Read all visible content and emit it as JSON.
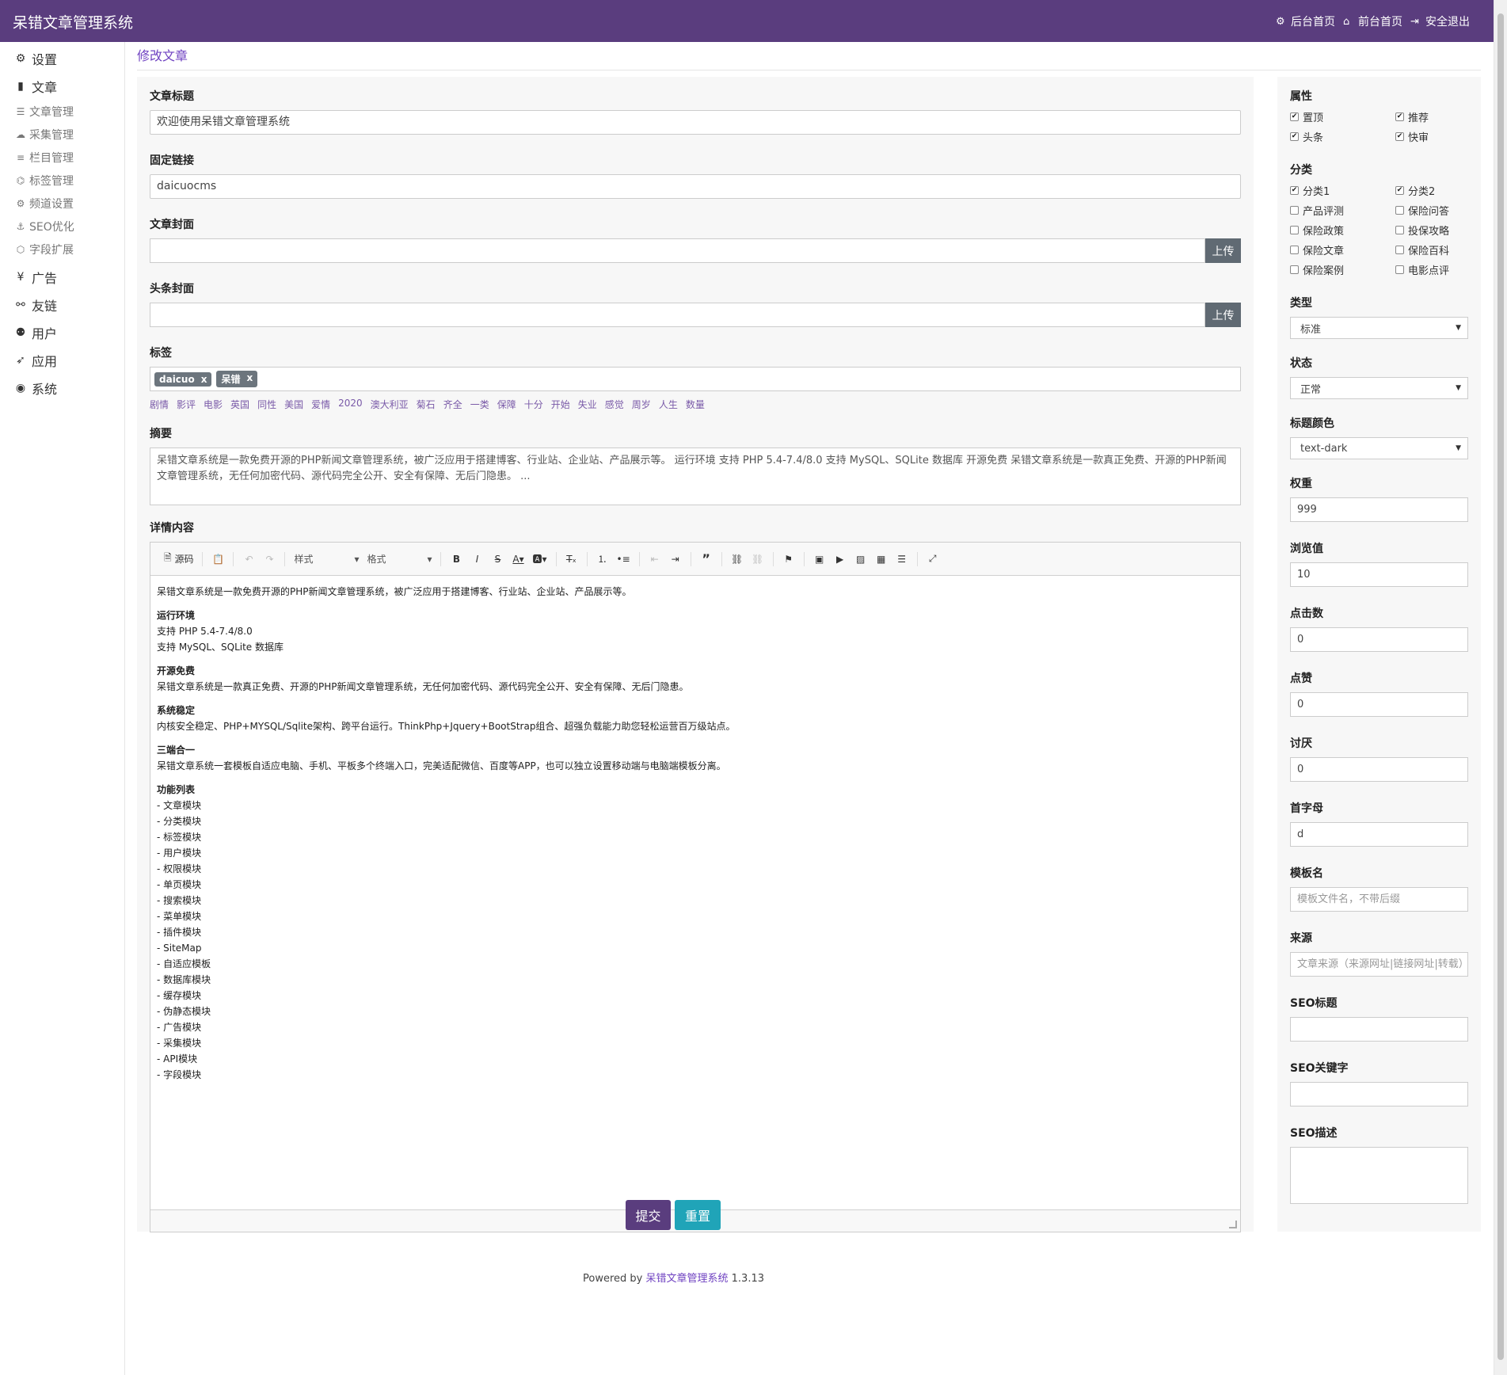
{
  "header": {
    "brand": "呆错文章管理系统",
    "links": [
      {
        "icon": "gear-icon",
        "glyph": "⚙",
        "label": "后台首页"
      },
      {
        "icon": "home-icon",
        "glyph": "⌂",
        "label": "前台首页"
      },
      {
        "icon": "logout-icon",
        "glyph": "⇥",
        "label": "安全退出"
      }
    ]
  },
  "sidebar": {
    "settings": {
      "glyph": "⚙",
      "label": "设置"
    },
    "article": {
      "glyph": "▮",
      "label": "文章"
    },
    "article_items": [
      {
        "glyph": "☰",
        "label": "文章管理"
      },
      {
        "glyph": "☁",
        "label": "采集管理"
      },
      {
        "glyph": "≡",
        "label": "栏目管理"
      },
      {
        "glyph": "⌬",
        "label": "标签管理"
      },
      {
        "glyph": "⚙",
        "label": "频道设置"
      },
      {
        "glyph": "⚓",
        "label": "SEO优化"
      },
      {
        "glyph": "⬡",
        "label": "字段扩展"
      }
    ],
    "others": [
      {
        "glyph": "¥",
        "label": "广告",
        "icon": "yen-icon"
      },
      {
        "glyph": "⚯",
        "label": "友链",
        "icon": "handshake-icon"
      },
      {
        "glyph": "⚉",
        "label": "用户",
        "icon": "users-icon"
      },
      {
        "glyph": "➶",
        "label": "应用",
        "icon": "rocket-icon"
      },
      {
        "glyph": "◉",
        "label": "系统",
        "icon": "dashboard-icon"
      }
    ]
  },
  "page": {
    "title": "修改文章"
  },
  "form": {
    "title_label": "文章标题",
    "title_value": "欢迎使用呆错文章管理系统",
    "slug_label": "固定链接",
    "slug_value": "daicuocms",
    "cover_label": "文章封面",
    "headline_cover_label": "头条封面",
    "upload_label": "上传",
    "tags_label": "标签",
    "tags": [
      "daicuo",
      "呆错"
    ],
    "tag_remove": "x",
    "tag_suggestions": [
      "剧情",
      "影评",
      "电影",
      "英国",
      "同性",
      "美国",
      "爱情",
      "2020",
      "澳大利亚",
      "菊石",
      "齐全",
      "一类",
      "保障",
      "十分",
      "开始",
      "失业",
      "感觉",
      "周岁",
      "人生",
      "数量"
    ],
    "summary_label": "摘要",
    "summary_value": "呆错文章系统是一款免费开源的PHP新闻文章管理系统，被广泛应用于搭建博客、行业站、企业站、产品展示等。 运行环境 支持 PHP 5.4-7.4/8.0 支持 MySQL、SQLite 数据库 开源免费 呆错文章系统是一款真正免费、开源的PHP新闻文章管理系统，无任何加密代码、源代码完全公开、安全有保障、无后门隐患。 ...",
    "content_label": "详情内容"
  },
  "editor": {
    "source_label": "源码",
    "style_combo": "样式",
    "format_combo": "格式",
    "intro": "呆错文章系统是一款免费开源的PHP新闻文章管理系统，被广泛应用于搭建博客、行业站、企业站、产品展示等。",
    "sections": [
      {
        "heading": "运行环境",
        "lines": [
          "支持 PHP 5.4-7.4/8.0",
          "支持 MySQL、SQLite 数据库"
        ]
      },
      {
        "heading": "开源免费",
        "lines": [
          "呆错文章系统是一款真正免费、开源的PHP新闻文章管理系统，无任何加密代码、源代码完全公开、安全有保障、无后门隐患。"
        ]
      },
      {
        "heading": "系统稳定",
        "lines": [
          "内核安全稳定、PHP+MYSQL/Sqlite架构、跨平台运行。ThinkPhp+Jquery+BootStrap组合、超强负载能力助您轻松运营百万级站点。"
        ]
      },
      {
        "heading": "三端合一",
        "lines": [
          "呆错文章系统一套模板自适应电脑、手机、平板多个终端入口，完美适配微信、百度等APP，也可以独立设置移动端与电脑端模板分离。"
        ]
      },
      {
        "heading": "功能列表",
        "lines": [
          "- 文章模块",
          "- 分类模块",
          "- 标签模块",
          "- 用户模块",
          "- 权限模块",
          "- 单页模块",
          "- 搜索模块",
          "- 菜单模块",
          "- 插件模块",
          "- SiteMap",
          "- 自适应模板",
          "- 数据库模块",
          "- 缓存模块",
          "- 伪静态模块",
          "- 广告模块",
          "- 采集模块",
          "- API模块",
          "- 字段模块"
        ]
      }
    ]
  },
  "right": {
    "attr_label": "属性",
    "attrs": [
      {
        "label": "置顶",
        "checked": true
      },
      {
        "label": "推荐",
        "checked": true
      },
      {
        "label": "头条",
        "checked": true
      },
      {
        "label": "快审",
        "checked": true
      }
    ],
    "category_label": "分类",
    "categories": [
      {
        "label": "分类1",
        "checked": true
      },
      {
        "label": "分类2",
        "checked": true
      },
      {
        "label": "产品评测",
        "checked": false
      },
      {
        "label": "保险问答",
        "checked": false
      },
      {
        "label": "保险政策",
        "checked": false
      },
      {
        "label": "投保攻略",
        "checked": false
      },
      {
        "label": "保险文章",
        "checked": false
      },
      {
        "label": "保险百科",
        "checked": false
      },
      {
        "label": "保险案例",
        "checked": false
      },
      {
        "label": "电影点评",
        "checked": false
      }
    ],
    "type_label": "类型",
    "type_value": "标准",
    "status_label": "状态",
    "status_value": "正常",
    "color_label": "标题颜色",
    "color_value": "text-dark",
    "weight_label": "权重",
    "weight_value": "999",
    "views_label": "浏览值",
    "views_value": "10",
    "clicks_label": "点击数",
    "clicks_value": "0",
    "likes_label": "点赞",
    "likes_value": "0",
    "dislikes_label": "讨厌",
    "dislikes_value": "0",
    "initial_label": "首字母",
    "initial_value": "d",
    "template_label": "模板名",
    "template_placeholder": "模板文件名，不带后缀",
    "source_label": "来源",
    "source_placeholder": "文章来源（来源网址|链接网址|转载）",
    "seo_title_label": "SEO标题",
    "seo_keywords_label": "SEO关键字",
    "seo_desc_label": "SEO描述"
  },
  "actions": {
    "submit": "提交",
    "reset": "重置"
  },
  "footer": {
    "prefix": "Powered by",
    "brand": "呆错文章管理系统",
    "version": "1.3.13"
  },
  "colors": {
    "brand": "#5a3d7e",
    "accent": "#6f42c1",
    "reset": "#20a4b8"
  }
}
